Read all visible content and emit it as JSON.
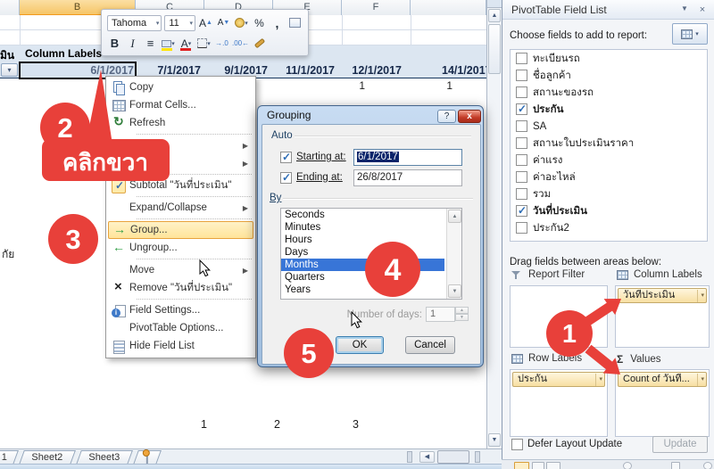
{
  "spreadsheet": {
    "column_headers": [
      "",
      "B",
      "C",
      "D",
      "E",
      "F",
      ""
    ],
    "pivot_row_field_partial": "มิน",
    "column_labels_header": "Column Labels",
    "dates": [
      "6/1/2017",
      "7/1/2017",
      "9/1/2017",
      "11/1/2017",
      "12/1/2017",
      "14/1/2017"
    ],
    "date_counts": [
      "1",
      "1"
    ],
    "row_partial_text": "กัย",
    "bottom_counts": [
      "1",
      "2",
      "3"
    ],
    "sheet_tabs": [
      "1",
      "Sheet2",
      "Sheet3"
    ]
  },
  "mini_toolbar": {
    "font_name": "Tahoma",
    "font_size": "11",
    "bold_label": "B",
    "italic_label": "I",
    "percent_label": "%",
    "comma_label": ","
  },
  "context_menu": {
    "items": [
      {
        "label": "Copy",
        "icon": "copy-icon"
      },
      {
        "label": "Format Cells...",
        "icon": "format-cells-icon"
      },
      {
        "label": "Refresh",
        "icon": "refresh-icon",
        "sep_after": true
      },
      {
        "label": "",
        "icon": "",
        "submenu": true
      },
      {
        "label": "",
        "icon": "",
        "submenu": true,
        "sep_after": true
      },
      {
        "label": "Subtotal \"วันที่ประเมิน\"",
        "icon": "checked-icon",
        "sep_after": true
      },
      {
        "label": "Expand/Collapse",
        "icon": "",
        "submenu": true,
        "sep_after": true
      },
      {
        "label": "Group...",
        "icon": "group-icon",
        "highlighted": true
      },
      {
        "label": "Ungroup...",
        "icon": "ungroup-icon",
        "sep_after": true
      },
      {
        "label": "Move",
        "icon": "",
        "submenu": true
      },
      {
        "label": "Remove \"วันที่ประเมิน\"",
        "icon": "remove-icon",
        "sep_after": true
      },
      {
        "label": "Field Settings...",
        "icon": "field-settings-icon"
      },
      {
        "label": "PivotTable Options...",
        "icon": ""
      },
      {
        "label": "Hide Field List",
        "icon": "hide-field-list-icon"
      }
    ]
  },
  "grouping_dialog": {
    "title": "Grouping",
    "help_glyph": "?",
    "close_glyph": "x",
    "auto_label": "Auto",
    "starting_label": "Starting at:",
    "starting_value": "6/1/2017",
    "ending_label": "Ending at:",
    "ending_value": "26/8/2017",
    "by_label": "By",
    "options": [
      "Seconds",
      "Minutes",
      "Hours",
      "Days",
      "Months",
      "Quarters",
      "Years"
    ],
    "selected_option": "Months",
    "days_label": "Number of days:",
    "days_value": "1",
    "ok_label": "OK",
    "cancel_label": "Cancel"
  },
  "field_list": {
    "title": "PivotTable Field List",
    "choose_label": "Choose fields to add to report:",
    "fields": [
      {
        "label": "ทะเบียนรถ",
        "checked": false
      },
      {
        "label": "ชื่อลูกค้า",
        "checked": false
      },
      {
        "label": "สถานะของรถ",
        "checked": false
      },
      {
        "label": "ประกัน",
        "checked": true
      },
      {
        "label": "SA",
        "checked": false
      },
      {
        "label": "สถานะใบประเมินราคา",
        "checked": false
      },
      {
        "label": "ค่าแรง",
        "checked": false
      },
      {
        "label": "ค่าอะไหล่",
        "checked": false
      },
      {
        "label": "รวม",
        "checked": false
      },
      {
        "label": "วันที่ประเมิน",
        "checked": true
      },
      {
        "label": "ประกัน2",
        "checked": false
      }
    ],
    "drag_label": "Drag fields between areas below:",
    "areas": {
      "report_filter": {
        "title": "Report Filter",
        "item": ""
      },
      "column_labels": {
        "title": "Column Labels",
        "item": "วันที่ประเมิน"
      },
      "row_labels": {
        "title": "Row Labels",
        "item": "ประกัน"
      },
      "values": {
        "title": "Values",
        "item": "Count of วันที่...",
        "icon_glyph": "Σ"
      }
    },
    "defer_label": "Defer Layout Update",
    "update_label": "Update"
  },
  "annotations": {
    "step1": "1",
    "step2": "2",
    "step3": "3",
    "step4": "4",
    "step5": "5",
    "callout_label": "คลิกขวา",
    "red": "#E8403A"
  }
}
